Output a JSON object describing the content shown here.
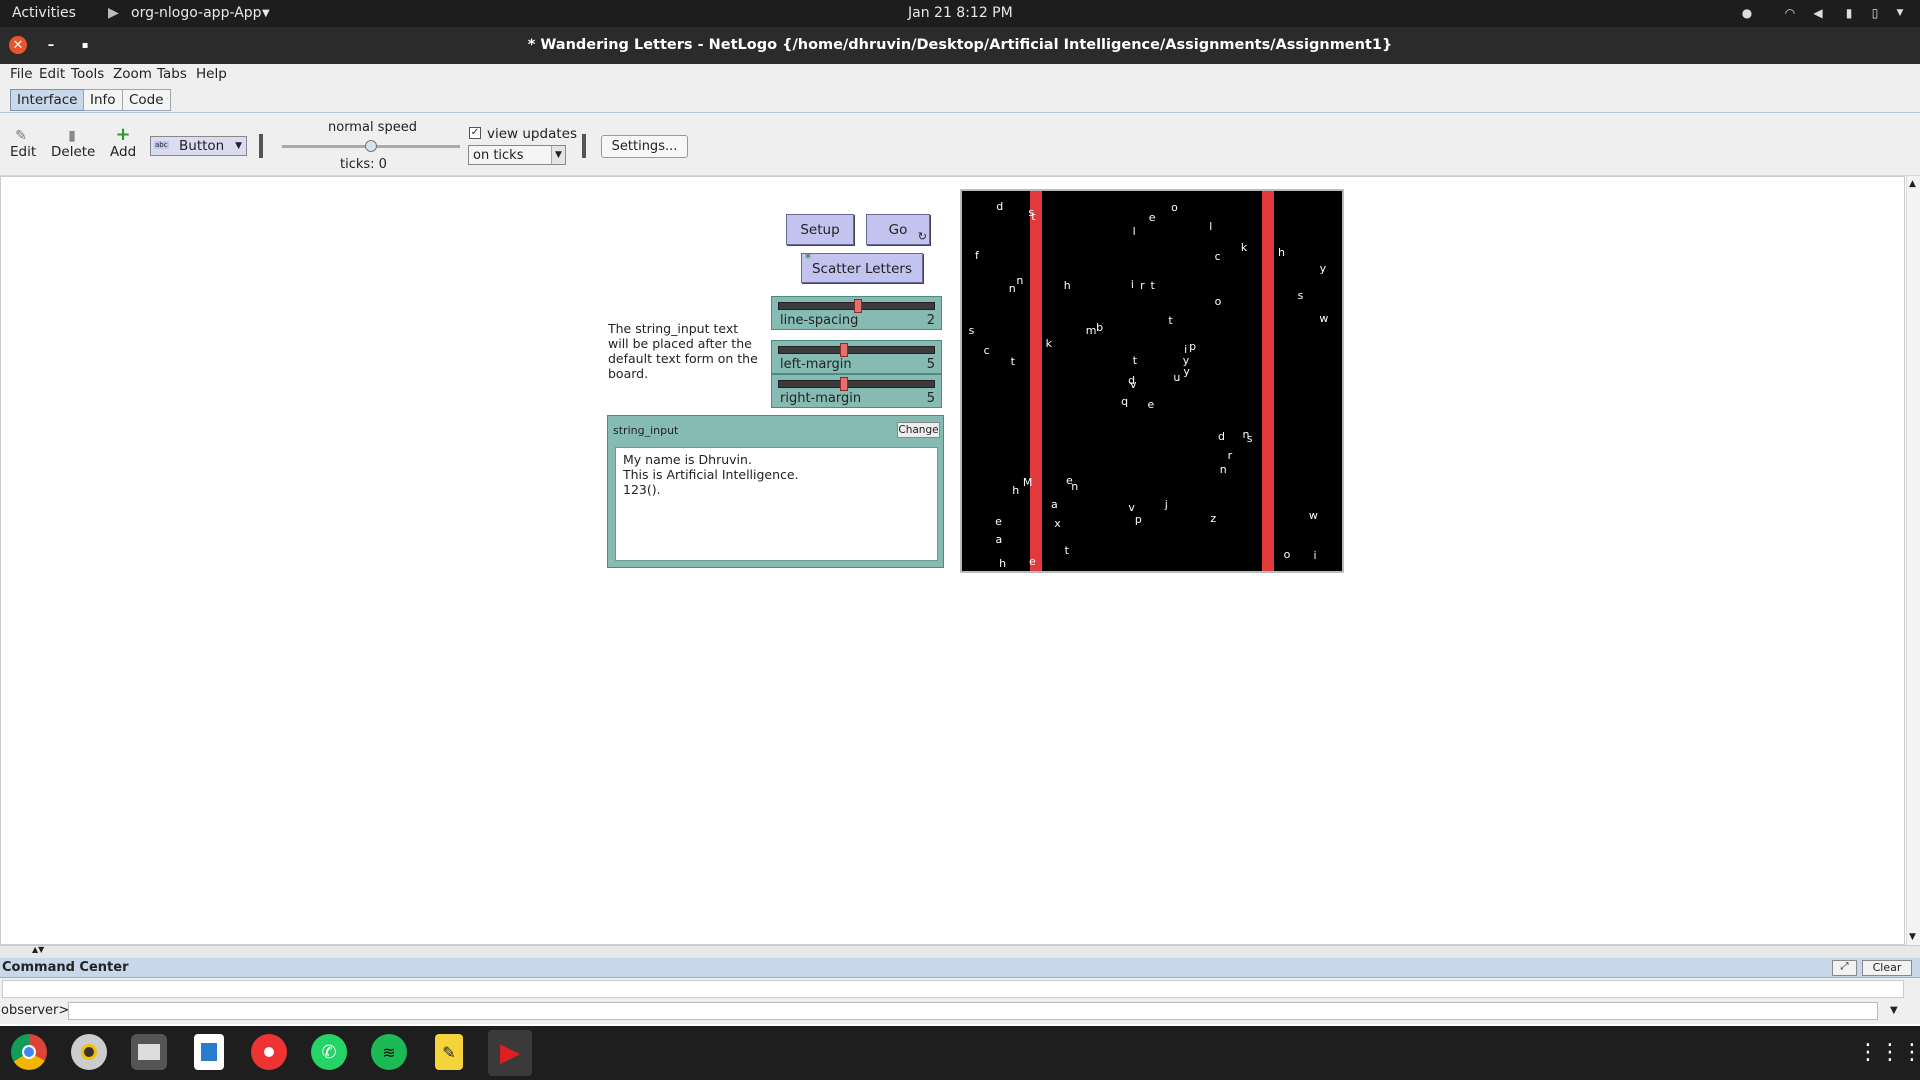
{
  "topbar": {
    "activities": "Activities",
    "app_name": "org-nlogo-app-App",
    "datetime": "Jan 21  8:12 PM"
  },
  "window": {
    "title": "* Wandering Letters - NetLogo {/home/dhruvin/Desktop/Artificial Intelligence/Assignments/Assignment1}"
  },
  "menu": [
    "File",
    "Edit",
    "Tools",
    "Zoom",
    "Tabs",
    "Help"
  ],
  "tabs": [
    "Interface",
    "Info",
    "Code"
  ],
  "toolbar": {
    "edit": "Edit",
    "delete": "Delete",
    "add": "Add",
    "widget_type": "Button",
    "speed_label": "normal speed",
    "speed_fraction": 0.5,
    "ticks": "ticks: 0",
    "view_updates": "view updates",
    "update_mode": "on ticks",
    "settings": "Settings..."
  },
  "widgets": {
    "setup": "Setup",
    "go": "Go",
    "scatter": "Scatter Letters",
    "note": "The string_input text will be placed after the default text form on the board.",
    "sliders": [
      {
        "label": "line-spacing",
        "value": "2"
      },
      {
        "label": "left-margin",
        "value": "5"
      },
      {
        "label": "right-margin",
        "value": "5"
      }
    ],
    "input_label": "string_input",
    "change": "Change",
    "input_lines": [
      "My name is Dhruvin.",
      "This is Artificial Intelligence.",
      "123()."
    ]
  },
  "view_letters": "e n v e i n l t c u t i t y q o e i t M b a x r p s n l c d w d v t h k e o w n o m k n t s y h p y h s f r z a s d j h e",
  "colors": {
    "view_bg": "#000000",
    "margin_bar": "#e03a3a",
    "button": "#c3c3ef",
    "slider": "#85bbb3"
  },
  "command_center": {
    "title": "Command Center",
    "clear": "Clear",
    "prompt": "observer>"
  },
  "taskbar_apps": [
    "chrome-icon",
    "rhythmbox-icon",
    "files-icon",
    "writer-icon",
    "help-icon",
    "whatsapp-icon",
    "spotify-icon",
    "notes-icon",
    "netlogo-icon"
  ]
}
